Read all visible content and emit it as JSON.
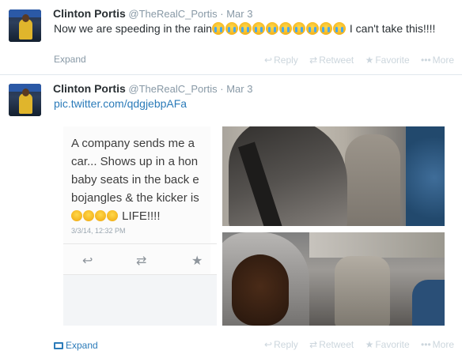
{
  "tweets": [
    {
      "name": "Clinton Portis",
      "handle": "@TheRealC_Portis",
      "separator": "·",
      "time": "Mar 3",
      "text_before": "Now we are speeding in the rain",
      "emoji_count": 10,
      "text_after": " I can't take this!!!!",
      "expand_label": "Expand",
      "actions": {
        "reply": "Reply",
        "retweet": "Retweet",
        "favorite": "Favorite",
        "more": "More"
      }
    },
    {
      "name": "Clinton Portis",
      "handle": "@TheRealC_Portis",
      "separator": "·",
      "time": "Mar 3",
      "link": "pic.twitter.com/qdgjebpAFa",
      "expand_label": "Expand",
      "actions": {
        "reply": "Reply",
        "retweet": "Retweet",
        "favorite": "Favorite",
        "more": "More"
      },
      "media": {
        "screenshot_lines": [
          "A company sends me a",
          "car... Shows up in a hon",
          "baby seats in the back e",
          "bojangles & the kicker is"
        ],
        "screenshot_last_line": "LIFE!!!!",
        "screenshot_emoji_count": 4,
        "screenshot_time": "3/3/14, 12:32 PM"
      }
    }
  ],
  "icons": {
    "reply": "↩",
    "retweet": "⇄",
    "favorite": "★",
    "more": "•••"
  },
  "colors": {
    "link": "#2b7bb9",
    "muted": "#8899a6",
    "action": "#ccd6dd"
  }
}
